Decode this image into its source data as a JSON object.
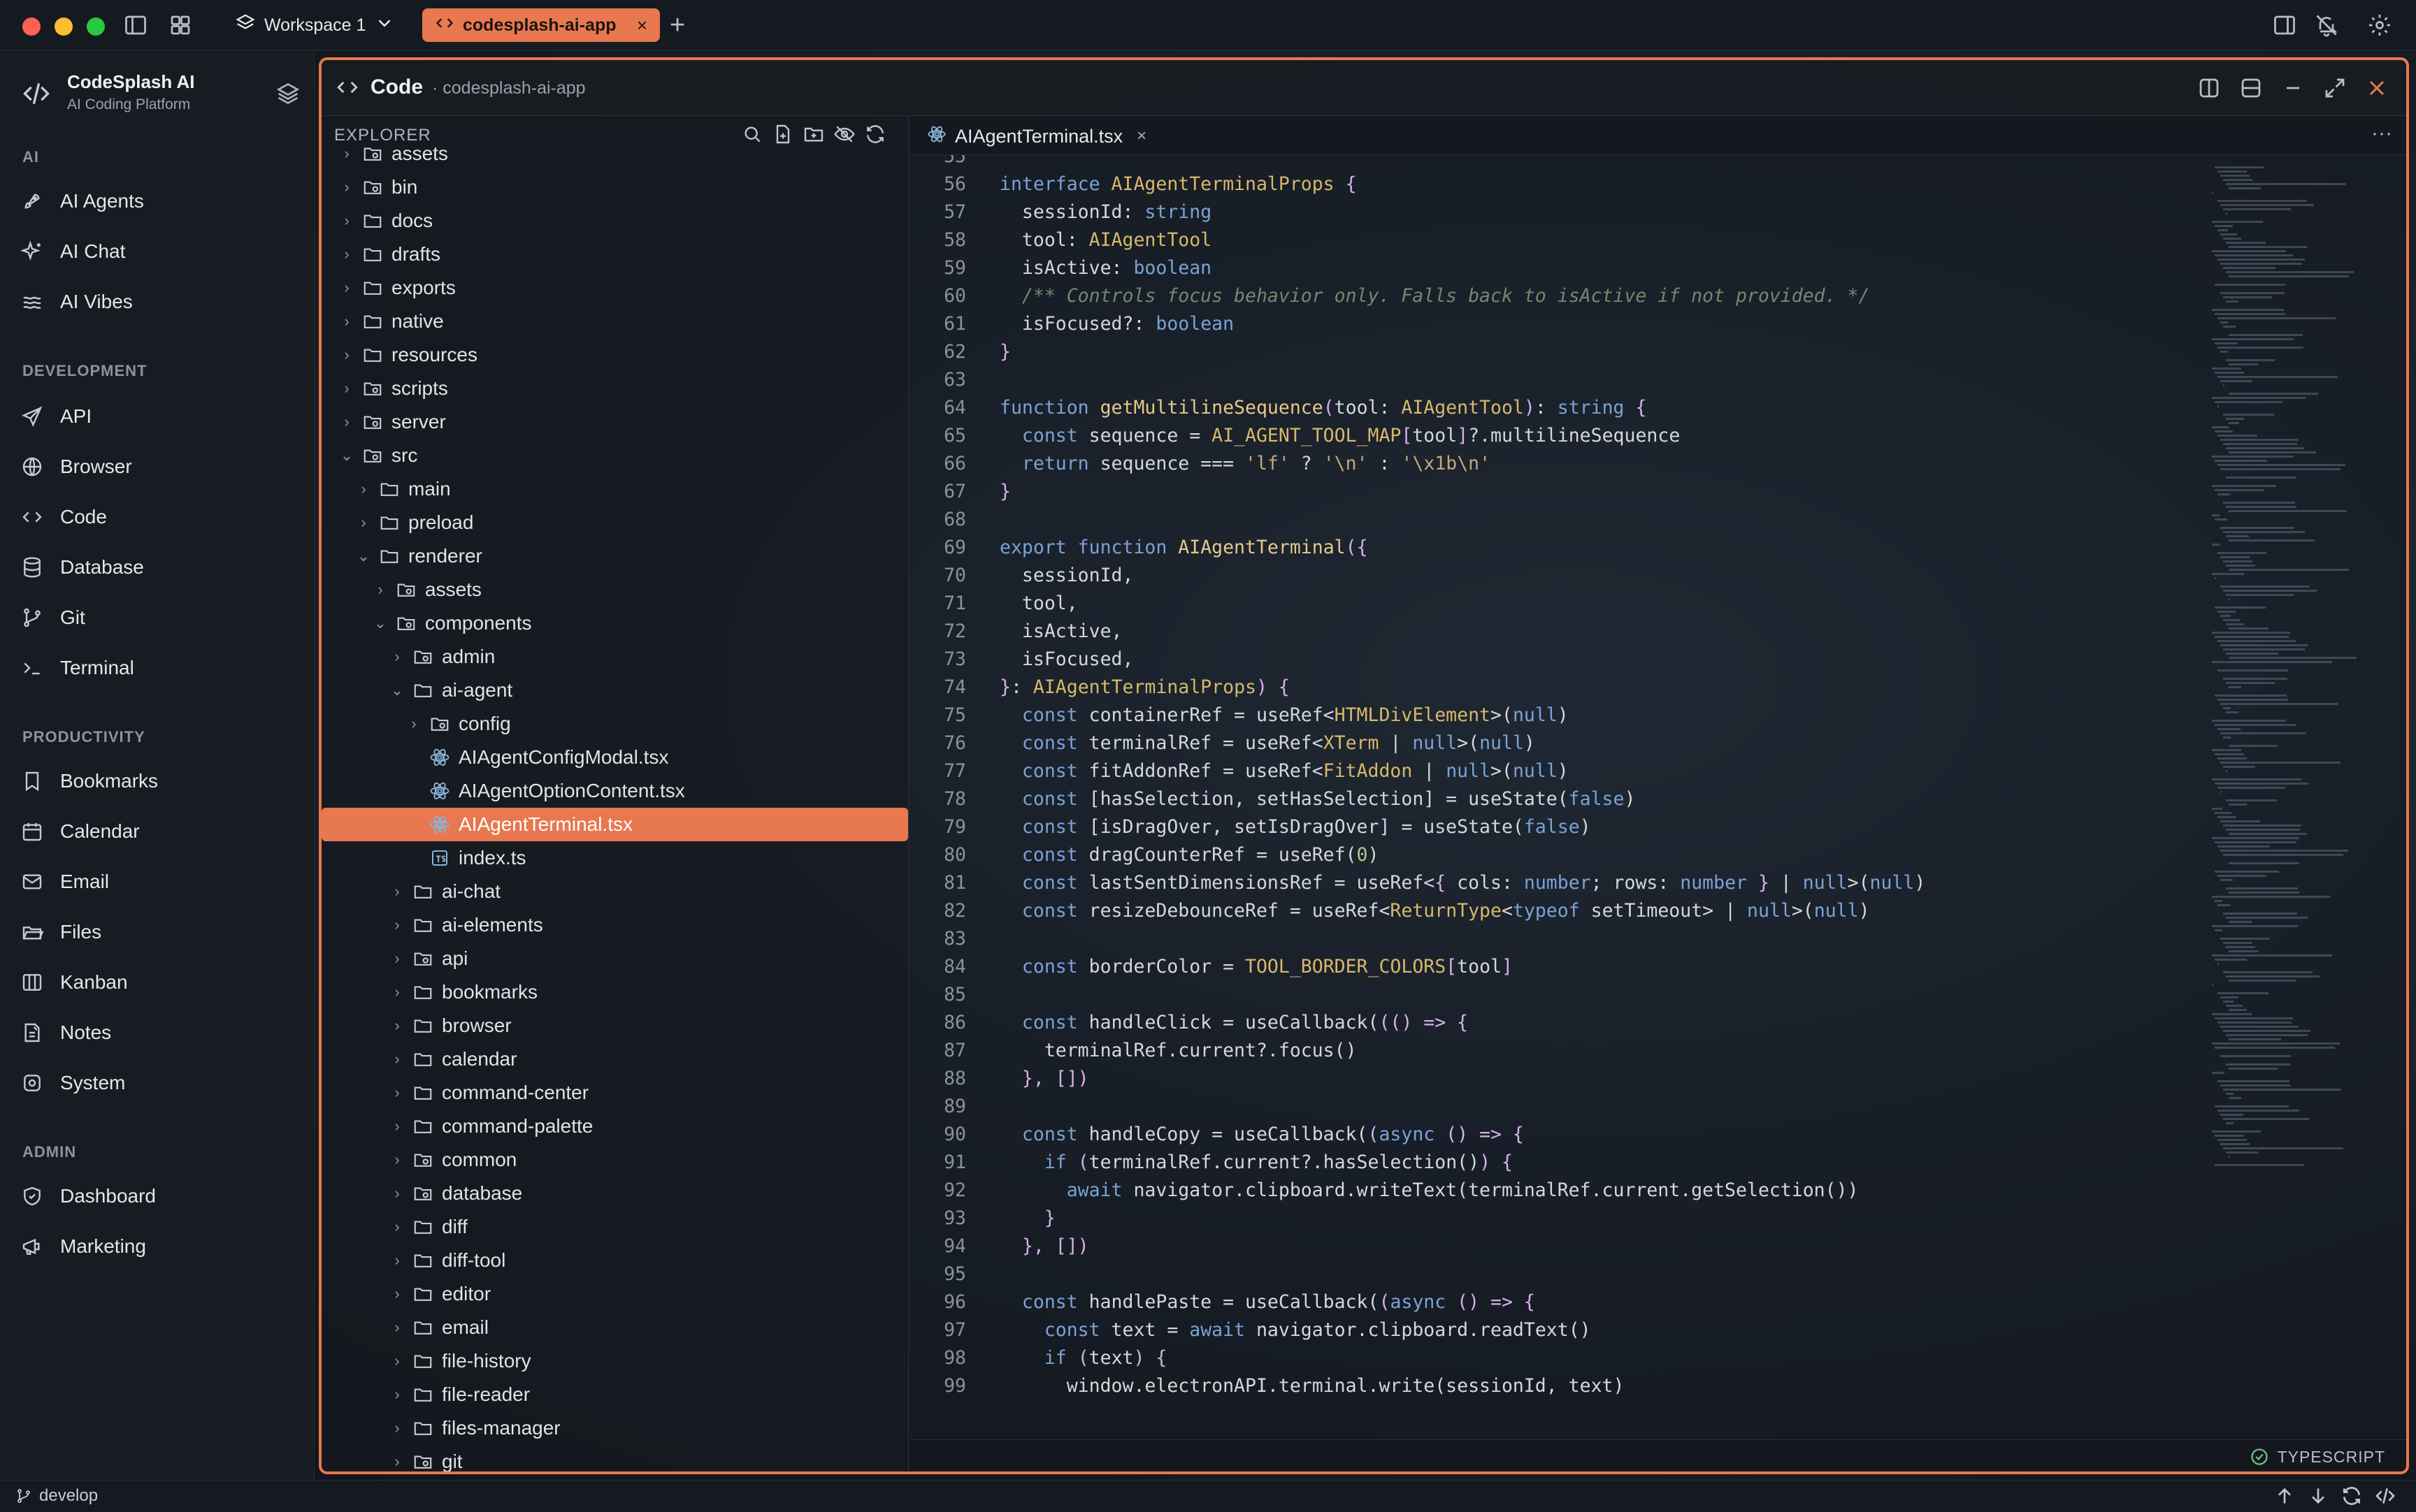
{
  "titlebar": {
    "workspace": "Workspace 1",
    "active_tab": "codesplash-ai-app",
    "close_glyph": "×",
    "new_tab_glyph": "+"
  },
  "brand": {
    "title": "CodeSplash AI",
    "subtitle": "AI Coding Platform"
  },
  "sections": {
    "ai": "AI",
    "development": "DEVELOPMENT",
    "productivity": "PRODUCTIVITY",
    "admin": "ADMIN"
  },
  "nav": {
    "ai": [
      "AI Agents",
      "AI Chat",
      "AI Vibes"
    ],
    "development": [
      "API",
      "Browser",
      "Code",
      "Database",
      "Git",
      "Terminal"
    ],
    "productivity": [
      "Bookmarks",
      "Calendar",
      "Email",
      "Files",
      "Kanban",
      "Notes",
      "System"
    ],
    "admin": [
      "Dashboard",
      "Marketing"
    ]
  },
  "panel": {
    "title": "Code",
    "subtitle": "· codesplash-ai-app"
  },
  "explorer": {
    "label": "EXPLORER",
    "tree": [
      {
        "name": "assets",
        "depth": 1,
        "open": false,
        "kind": "folder-special"
      },
      {
        "name": "bin",
        "depth": 1,
        "open": false,
        "kind": "folder-special"
      },
      {
        "name": "docs",
        "depth": 1,
        "open": false,
        "kind": "folder"
      },
      {
        "name": "drafts",
        "depth": 1,
        "open": false,
        "kind": "folder"
      },
      {
        "name": "exports",
        "depth": 1,
        "open": false,
        "kind": "folder"
      },
      {
        "name": "native",
        "depth": 1,
        "open": false,
        "kind": "folder"
      },
      {
        "name": "resources",
        "depth": 1,
        "open": false,
        "kind": "folder"
      },
      {
        "name": "scripts",
        "depth": 1,
        "open": false,
        "kind": "folder-special"
      },
      {
        "name": "server",
        "depth": 1,
        "open": false,
        "kind": "folder-special"
      },
      {
        "name": "src",
        "depth": 1,
        "open": true,
        "kind": "folder-special"
      },
      {
        "name": "main",
        "depth": 2,
        "open": false,
        "kind": "folder"
      },
      {
        "name": "preload",
        "depth": 2,
        "open": false,
        "kind": "folder"
      },
      {
        "name": "renderer",
        "depth": 2,
        "open": true,
        "kind": "folder"
      },
      {
        "name": "assets",
        "depth": 3,
        "open": false,
        "kind": "folder-special"
      },
      {
        "name": "components",
        "depth": 3,
        "open": true,
        "kind": "folder-special"
      },
      {
        "name": "admin",
        "depth": 4,
        "open": false,
        "kind": "folder-special"
      },
      {
        "name": "ai-agent",
        "depth": 4,
        "open": true,
        "kind": "folder"
      },
      {
        "name": "config",
        "depth": 5,
        "open": false,
        "kind": "folder-special"
      },
      {
        "name": "AIAgentConfigModal.tsx",
        "depth": 5,
        "open": null,
        "kind": "react"
      },
      {
        "name": "AIAgentOptionContent.tsx",
        "depth": 5,
        "open": null,
        "kind": "react"
      },
      {
        "name": "AIAgentTerminal.tsx",
        "depth": 5,
        "open": null,
        "kind": "react",
        "selected": true
      },
      {
        "name": "index.ts",
        "depth": 5,
        "open": null,
        "kind": "ts"
      },
      {
        "name": "ai-chat",
        "depth": 4,
        "open": false,
        "kind": "folder"
      },
      {
        "name": "ai-elements",
        "depth": 4,
        "open": false,
        "kind": "folder"
      },
      {
        "name": "api",
        "depth": 4,
        "open": false,
        "kind": "folder-special"
      },
      {
        "name": "bookmarks",
        "depth": 4,
        "open": false,
        "kind": "folder"
      },
      {
        "name": "browser",
        "depth": 4,
        "open": false,
        "kind": "folder"
      },
      {
        "name": "calendar",
        "depth": 4,
        "open": false,
        "kind": "folder"
      },
      {
        "name": "command-center",
        "depth": 4,
        "open": false,
        "kind": "folder"
      },
      {
        "name": "command-palette",
        "depth": 4,
        "open": false,
        "kind": "folder"
      },
      {
        "name": "common",
        "depth": 4,
        "open": false,
        "kind": "folder-special"
      },
      {
        "name": "database",
        "depth": 4,
        "open": false,
        "kind": "folder-special"
      },
      {
        "name": "diff",
        "depth": 4,
        "open": false,
        "kind": "folder"
      },
      {
        "name": "diff-tool",
        "depth": 4,
        "open": false,
        "kind": "folder"
      },
      {
        "name": "editor",
        "depth": 4,
        "open": false,
        "kind": "folder"
      },
      {
        "name": "email",
        "depth": 4,
        "open": false,
        "kind": "folder"
      },
      {
        "name": "file-history",
        "depth": 4,
        "open": false,
        "kind": "folder"
      },
      {
        "name": "file-reader",
        "depth": 4,
        "open": false,
        "kind": "folder"
      },
      {
        "name": "files-manager",
        "depth": 4,
        "open": false,
        "kind": "folder"
      },
      {
        "name": "git",
        "depth": 4,
        "open": false,
        "kind": "folder-special"
      }
    ]
  },
  "editor": {
    "file_tab": "AIAgentTerminal.tsx",
    "more_glyph": "···",
    "language": "TYPESCRIPT",
    "first_line_no": 55,
    "lines": [
      [],
      [
        [
          "kw",
          "interface "
        ],
        [
          "ty",
          "AIAgentTerminalProps "
        ],
        [
          "pu",
          "{"
        ]
      ],
      [
        [
          "",
          "  sessionId: "
        ],
        [
          "kw",
          "string"
        ]
      ],
      [
        [
          "",
          "  tool: "
        ],
        [
          "ty",
          "AIAgentTool"
        ]
      ],
      [
        [
          "",
          "  isActive: "
        ],
        [
          "kw",
          "boolean"
        ]
      ],
      [
        [
          "cm",
          "  /** Controls focus behavior only. Falls back to isActive if not provided. */"
        ]
      ],
      [
        [
          "",
          "  isFocused?: "
        ],
        [
          "kw",
          "boolean"
        ]
      ],
      [
        [
          "pu",
          "}"
        ]
      ],
      [],
      [
        [
          "kw",
          "function "
        ],
        [
          "fn",
          "getMultilineSequence"
        ],
        [
          "pu",
          "("
        ],
        [
          "",
          "tool: "
        ],
        [
          "ty",
          "AIAgentTool"
        ],
        [
          "pu",
          ")"
        ],
        [
          "",
          ": "
        ],
        [
          "kw",
          "string "
        ],
        [
          "pu",
          "{"
        ]
      ],
      [
        [
          "kw",
          "  const "
        ],
        [
          "",
          "sequence = "
        ],
        [
          "ty",
          "AI_AGENT_TOOL_MAP"
        ],
        [
          "pu",
          "["
        ],
        [
          "",
          "tool"
        ],
        [
          "pu",
          "]"
        ],
        [
          "",
          "?.multilineSequence"
        ]
      ],
      [
        [
          "kw",
          "  return "
        ],
        [
          "",
          "sequence === "
        ],
        [
          "st",
          "'lf'"
        ],
        [
          "",
          " ? "
        ],
        [
          "st",
          "'\\n'"
        ],
        [
          "",
          " : "
        ],
        [
          "st",
          "'\\x1b\\n'"
        ]
      ],
      [
        [
          "pu",
          "}"
        ]
      ],
      [],
      [
        [
          "kw",
          "export function "
        ],
        [
          "fn",
          "AIAgentTerminal"
        ],
        [
          "pu",
          "({"
        ]
      ],
      [
        [
          "",
          "  sessionId,"
        ]
      ],
      [
        [
          "",
          "  tool,"
        ]
      ],
      [
        [
          "",
          "  isActive,"
        ]
      ],
      [
        [
          "",
          "  isFocused,"
        ]
      ],
      [
        [
          "pu",
          "}"
        ],
        [
          "",
          ": "
        ],
        [
          "ty",
          "AIAgentTerminalProps"
        ],
        [
          "pu",
          ") {"
        ]
      ],
      [
        [
          "kw",
          "  const "
        ],
        [
          "",
          "containerRef = useRef<"
        ],
        [
          "ty",
          "HTMLDivElement"
        ],
        [
          "",
          ">("
        ],
        [
          "kw",
          "null"
        ],
        [
          "",
          ")"
        ]
      ],
      [
        [
          "kw",
          "  const "
        ],
        [
          "",
          "terminalRef = useRef<"
        ],
        [
          "ty",
          "XTerm"
        ],
        [
          "",
          " | "
        ],
        [
          "kw",
          "null"
        ],
        [
          "",
          ">("
        ],
        [
          "kw",
          "null"
        ],
        [
          "",
          ")"
        ]
      ],
      [
        [
          "kw",
          "  const "
        ],
        [
          "",
          "fitAddonRef = useRef<"
        ],
        [
          "ty",
          "FitAddon"
        ],
        [
          "",
          " | "
        ],
        [
          "kw",
          "null"
        ],
        [
          "",
          ">("
        ],
        [
          "kw",
          "null"
        ],
        [
          "",
          ")"
        ]
      ],
      [
        [
          "kw",
          "  const "
        ],
        [
          "",
          "[hasSelection, setHasSelection] = useState("
        ],
        [
          "kw",
          "false"
        ],
        [
          "",
          ")"
        ]
      ],
      [
        [
          "kw",
          "  const "
        ],
        [
          "",
          "[isDragOver, setIsDragOver] = useState("
        ],
        [
          "kw",
          "false"
        ],
        [
          "",
          ")"
        ]
      ],
      [
        [
          "kw",
          "  const "
        ],
        [
          "",
          "dragCounterRef = useRef("
        ],
        [
          "nm",
          "0"
        ],
        [
          "",
          ")"
        ]
      ],
      [
        [
          "kw",
          "  const "
        ],
        [
          "",
          "lastSentDimensionsRef = useRef<"
        ],
        [
          "pu",
          "{ "
        ],
        [
          "",
          "cols: "
        ],
        [
          "kw",
          "number"
        ],
        [
          "",
          "; rows: "
        ],
        [
          "kw",
          "number "
        ],
        [
          "pu",
          "}"
        ],
        [
          "",
          " | "
        ],
        [
          "kw",
          "null"
        ],
        [
          "",
          ">("
        ],
        [
          "kw",
          "null"
        ],
        [
          "",
          ")"
        ]
      ],
      [
        [
          "kw",
          "  const "
        ],
        [
          "",
          "resizeDebounceRef = useRef<"
        ],
        [
          "ty",
          "ReturnType"
        ],
        [
          "",
          "<"
        ],
        [
          "kw",
          "typeof "
        ],
        [
          "",
          "setTimeout> | "
        ],
        [
          "kw",
          "null"
        ],
        [
          "",
          ">("
        ],
        [
          "kw",
          "null"
        ],
        [
          "",
          ")"
        ]
      ],
      [],
      [
        [
          "kw",
          "  const "
        ],
        [
          "",
          "borderColor = "
        ],
        [
          "ty",
          "TOOL_BORDER_COLORS"
        ],
        [
          "pu",
          "["
        ],
        [
          "",
          "tool"
        ],
        [
          "pu",
          "]"
        ]
      ],
      [],
      [
        [
          "kw",
          "  const "
        ],
        [
          "",
          "handleClick = useCallback("
        ],
        [
          "pu",
          "(() => {"
        ]
      ],
      [
        [
          "",
          "    terminalRef.current?.focus()"
        ]
      ],
      [
        [
          "pu",
          "  }, [])"
        ]
      ],
      [],
      [
        [
          "kw",
          "  const "
        ],
        [
          "",
          "handleCopy = useCallback("
        ],
        [
          "pu",
          "("
        ],
        [
          "kw",
          "async "
        ],
        [
          "pu",
          "() => {"
        ]
      ],
      [
        [
          "kw",
          "    if "
        ],
        [
          "pu",
          "("
        ],
        [
          "",
          "terminalRef.current?.hasSelection()"
        ],
        [
          "pu",
          ") {"
        ]
      ],
      [
        [
          "kw",
          "      await "
        ],
        [
          "",
          "navigator.clipboard.writeText(terminalRef.current.getSelection())"
        ]
      ],
      [
        [
          "pu",
          "    }"
        ]
      ],
      [
        [
          "pu",
          "  }, [])"
        ]
      ],
      [],
      [
        [
          "kw",
          "  const "
        ],
        [
          "",
          "handlePaste = useCallback("
        ],
        [
          "pu",
          "("
        ],
        [
          "kw",
          "async "
        ],
        [
          "pu",
          "() => {"
        ]
      ],
      [
        [
          "kw",
          "    const "
        ],
        [
          "",
          "text = "
        ],
        [
          "kw",
          "await "
        ],
        [
          "",
          "navigator.clipboard.readText()"
        ]
      ],
      [
        [
          "kw",
          "    if "
        ],
        [
          "pu",
          "("
        ],
        [
          "",
          "text"
        ],
        [
          "pu",
          ") {"
        ]
      ],
      [
        [
          "",
          "      window.electronAPI.terminal.write(sessionId, text)"
        ]
      ],
      [
        [
          "pu",
          "    }"
        ]
      ]
    ]
  },
  "status": {
    "branch": "develop"
  },
  "colors": {
    "accent": "#e8784f",
    "background": "#14191f"
  },
  "icons": {
    "titlebar": [
      "sidebar-toggle-icon",
      "grid-icon",
      "layers-icon",
      "split-panel-icon",
      "notifications-off-icon",
      "gear-icon"
    ],
    "panel": [
      "split-vertical-icon",
      "split-horizontal-icon",
      "minimize-icon",
      "maximize-icon",
      "close-icon"
    ],
    "explorer": [
      "search-icon",
      "new-file-icon",
      "new-folder-icon",
      "hide-icon",
      "refresh-icon"
    ],
    "status": [
      "arrow-up-icon",
      "arrow-down-icon",
      "sync-icon",
      "code-icon"
    ]
  }
}
